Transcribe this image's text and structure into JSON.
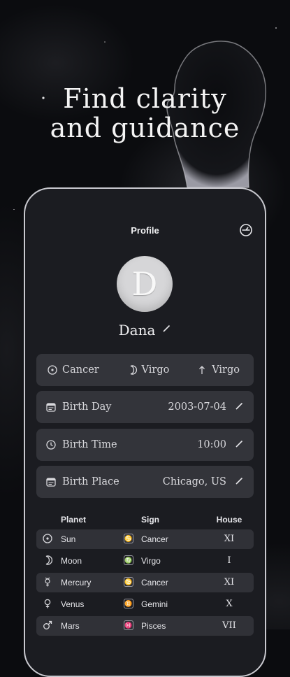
{
  "headline": {
    "line1": "Find clarity",
    "line2": "and guidance"
  },
  "screen": {
    "title": "Profile",
    "avatar_letter": "D",
    "name": "Dana"
  },
  "signs": [
    {
      "icon": "sun-icon",
      "label": "Cancer"
    },
    {
      "icon": "moon-icon",
      "label": "Virgo"
    },
    {
      "icon": "rising-arrow-icon",
      "label": "Virgo"
    }
  ],
  "fields": [
    {
      "icon": "calendar-icon",
      "label": "Birth Day",
      "value": "2003-07-04"
    },
    {
      "icon": "clock-icon",
      "label": "Birth Time",
      "value": "10:00"
    },
    {
      "icon": "calendar-icon",
      "label": "Birth Place",
      "value": "Chicago, US"
    }
  ],
  "table": {
    "headers": {
      "planet": "Planet",
      "sign": "Sign",
      "house": "House"
    },
    "rows": [
      {
        "planet": "Sun",
        "sign": "Cancer",
        "house": "XI",
        "sign_glyph": "♋"
      },
      {
        "planet": "Moon",
        "sign": "Virgo",
        "house": "I",
        "sign_glyph": "♍"
      },
      {
        "planet": "Mercury",
        "sign": "Cancer",
        "house": "XI",
        "sign_glyph": "♋"
      },
      {
        "planet": "Venus",
        "sign": "Gemini",
        "house": "X",
        "sign_glyph": "♊"
      },
      {
        "planet": "Mars",
        "sign": "Pisces",
        "house": "VII",
        "sign_glyph": "♓"
      }
    ]
  }
}
